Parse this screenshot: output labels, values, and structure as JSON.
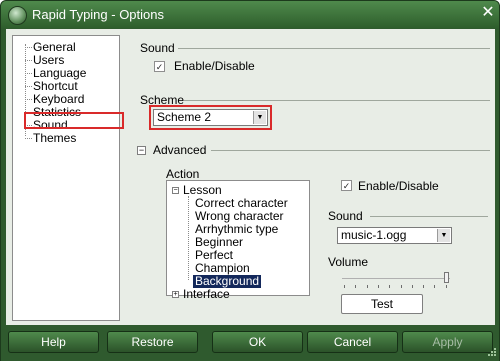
{
  "window": {
    "title": "Rapid Typing - Options",
    "close_glyph": "✕"
  },
  "nav": {
    "items": [
      {
        "label": "General"
      },
      {
        "label": "Users"
      },
      {
        "label": "Language"
      },
      {
        "label": "Shortcut"
      },
      {
        "label": "Keyboard"
      },
      {
        "label": "Statistics"
      },
      {
        "label": "Sound",
        "selected": true
      },
      {
        "label": "Themes"
      }
    ]
  },
  "sound": {
    "section_label": "Sound",
    "enable_label": "Enable/Disable",
    "enabled": true
  },
  "scheme": {
    "section_label": "Scheme",
    "selected": "Scheme 2"
  },
  "advanced": {
    "section_label": "Advanced",
    "expanded": true,
    "action_label": "Action",
    "tree": {
      "root1": "Lesson",
      "lesson_children": [
        {
          "label": "Correct character"
        },
        {
          "label": "Wrong character"
        },
        {
          "label": "Arrhythmic type"
        },
        {
          "label": "Beginner"
        },
        {
          "label": "Perfect"
        },
        {
          "label": "Champion"
        },
        {
          "label": "Background",
          "selected": true
        }
      ],
      "root2": "Interface"
    },
    "enable_label": "Enable/Disable",
    "enabled": true,
    "sound_label": "Sound",
    "sound_file": "music-1.ogg",
    "volume_label": "Volume",
    "volume_level": 1.0,
    "test_label": "Test"
  },
  "footer": {
    "help": "Help",
    "restore": "Restore",
    "ok": "OK",
    "cancel": "Cancel",
    "apply": "Apply",
    "apply_disabled": true
  },
  "icons": {
    "app": "rapid-typing-logo-icon",
    "close": "close-icon",
    "dropdown": "chevron-down-icon",
    "collapse": "minus-square-icon",
    "expand": "plus-square-icon",
    "grip": "resize-grip-icon"
  },
  "colors": {
    "theme_green": "#2f5a2e",
    "panel_bg": "#e8ede6",
    "selection": "#13285b",
    "highlight_red": "#d92a2a"
  }
}
